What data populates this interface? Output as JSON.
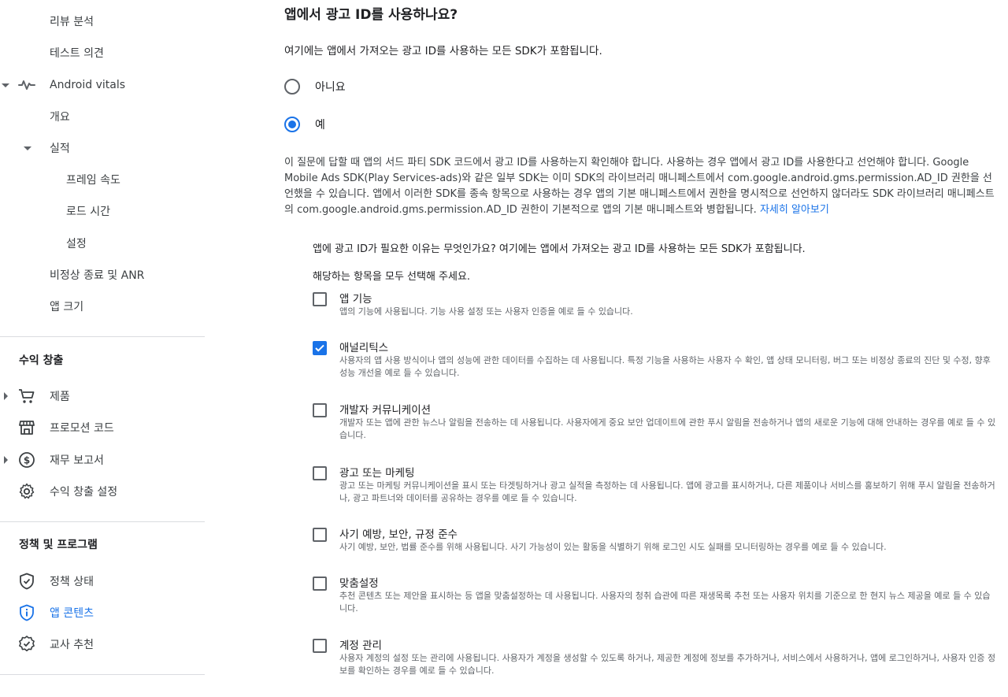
{
  "sidebar": {
    "items_top": [
      {
        "label": "리뷰 분석"
      },
      {
        "label": "테스트 의견"
      },
      {
        "label": "Android vitals"
      },
      {
        "label": "개요"
      },
      {
        "label": "실적"
      },
      {
        "label": "프레임 속도"
      },
      {
        "label": "로드 시간"
      },
      {
        "label": "설정"
      },
      {
        "label": "비정상 종료 및 ANR"
      },
      {
        "label": "앱 크기"
      }
    ],
    "monetize": {
      "title": "수익 창출",
      "items": [
        {
          "label": "제품",
          "icon": "cart-icon"
        },
        {
          "label": "프로모션 코드",
          "icon": "store-icon"
        },
        {
          "label": "재무 보고서",
          "icon": "dollar-icon"
        },
        {
          "label": "수익 창출 설정",
          "icon": "gear-icon"
        }
      ]
    },
    "policy": {
      "title": "정책 및 프로그램",
      "items": [
        {
          "label": "정책 상태",
          "icon": "shield-check-icon"
        },
        {
          "label": "앱 콘텐츠",
          "icon": "shield-info-icon"
        },
        {
          "label": "교사 추천",
          "icon": "badge-icon"
        }
      ]
    }
  },
  "main": {
    "title": "앱에서 광고 ID를 사용하나요?",
    "subtitle": "여기에는 앱에서 가져오는 광고 ID를 사용하는 모든 SDK가 포함됩니다.",
    "radios": [
      {
        "label": "아니요",
        "checked": false
      },
      {
        "label": "예",
        "checked": true
      }
    ],
    "paragraph": "이 질문에 답할 때 앱의 서드 파티 SDK 코드에서 광고 ID를 사용하는지 확인해야 합니다. 사용하는 경우 앱에서 광고 ID를 사용한다고 선언해야 합니다. Google Mobile Ads SDK(Play Services-ads)와 같은 일부 SDK는 이미 SDK의 라이브러리 매니페스트에서 com.google.android.gms.permission.AD_ID 권한을 선언했을 수 있습니다. 앱에서 이러한 SDK를 종속 항목으로 사용하는 경우 앱의 기본 매니페스트에서 권한을 명시적으로 선언하지 않더라도 SDK 라이브러리 매니페스트의 com.google.android.gms.permission.AD_ID 권한이 기본적으로 앱의 기본 매니페스트와 병합됩니다.",
    "learn_more": "자세히 알아보기",
    "reason_question": "앱에 광고 ID가 필요한 이유는 무엇인가요? 여기에는 앱에서 가져오는 광고 ID를 사용하는 모든 SDK가 포함됩니다.",
    "reason_hint": "해당하는 항목을 모두 선택해 주세요.",
    "options": [
      {
        "title": "앱 기능",
        "desc": "앱의 기능에 사용됩니다. 기능 사용 설정 또는 사용자 인증을 예로 들 수 있습니다.",
        "checked": false
      },
      {
        "title": "애널리틱스",
        "desc": "사용자의 앱 사용 방식이나 앱의 성능에 관한 데이터를 수집하는 데 사용됩니다. 특정 기능을 사용하는 사용자 수 확인, 앱 상태 모니터링, 버그 또는 비정상 종료의 진단 및 수정, 향후 성능 개선을 예로 들 수 있습니다.",
        "checked": true
      },
      {
        "title": "개발자 커뮤니케이션",
        "desc": "개발자 또는 앱에 관한 뉴스나 알림을 전송하는 데 사용됩니다. 사용자에게 중요 보안 업데이트에 관한 푸시 알림을 전송하거나 앱의 새로운 기능에 대해 안내하는 경우를 예로 들 수 있습니다.",
        "checked": false
      },
      {
        "title": "광고 또는 마케팅",
        "desc": "광고 또는 마케팅 커뮤니케이션을 표시 또는 타겟팅하거나 광고 실적을 측정하는 데 사용됩니다. 앱에 광고를 표시하거나, 다른 제품이나 서비스를 홍보하기 위해 푸시 알림을 전송하거나, 광고 파트너와 데이터를 공유하는 경우를 예로 들 수 있습니다.",
        "checked": false
      },
      {
        "title": "사기 예방, 보안, 규정 준수",
        "desc": "사기 예방, 보안, 법률 준수를 위해 사용됩니다. 사기 가능성이 있는 활동을 식별하기 위해 로그인 시도 실패를 모니터링하는 경우를 예로 들 수 있습니다.",
        "checked": false
      },
      {
        "title": "맞춤설정",
        "desc": "추천 콘텐츠 또는 제안을 표시하는 등 앱을 맞춤설정하는 데 사용됩니다. 사용자의 청취 습관에 따른 재생목록 추천 또는 사용자 위치를 기준으로 한 현지 뉴스 제공을 예로 들 수 있습니다.",
        "checked": false
      },
      {
        "title": "계정 관리",
        "desc": "사용자 계정의 설정 또는 관리에 사용됩니다. 사용자가 계정을 생성할 수 있도록 하거나, 제공한 계정에 정보를 추가하거나, 서비스에서 사용하거나, 앱에 로그인하거나, 사용자 인증 정보를 확인하는 경우를 예로 들 수 있습니다.",
        "checked": false
      }
    ]
  },
  "colors": {
    "accent": "#1a73e8",
    "text": "#202124",
    "muted": "#5f6368",
    "divider": "#dadce0"
  }
}
